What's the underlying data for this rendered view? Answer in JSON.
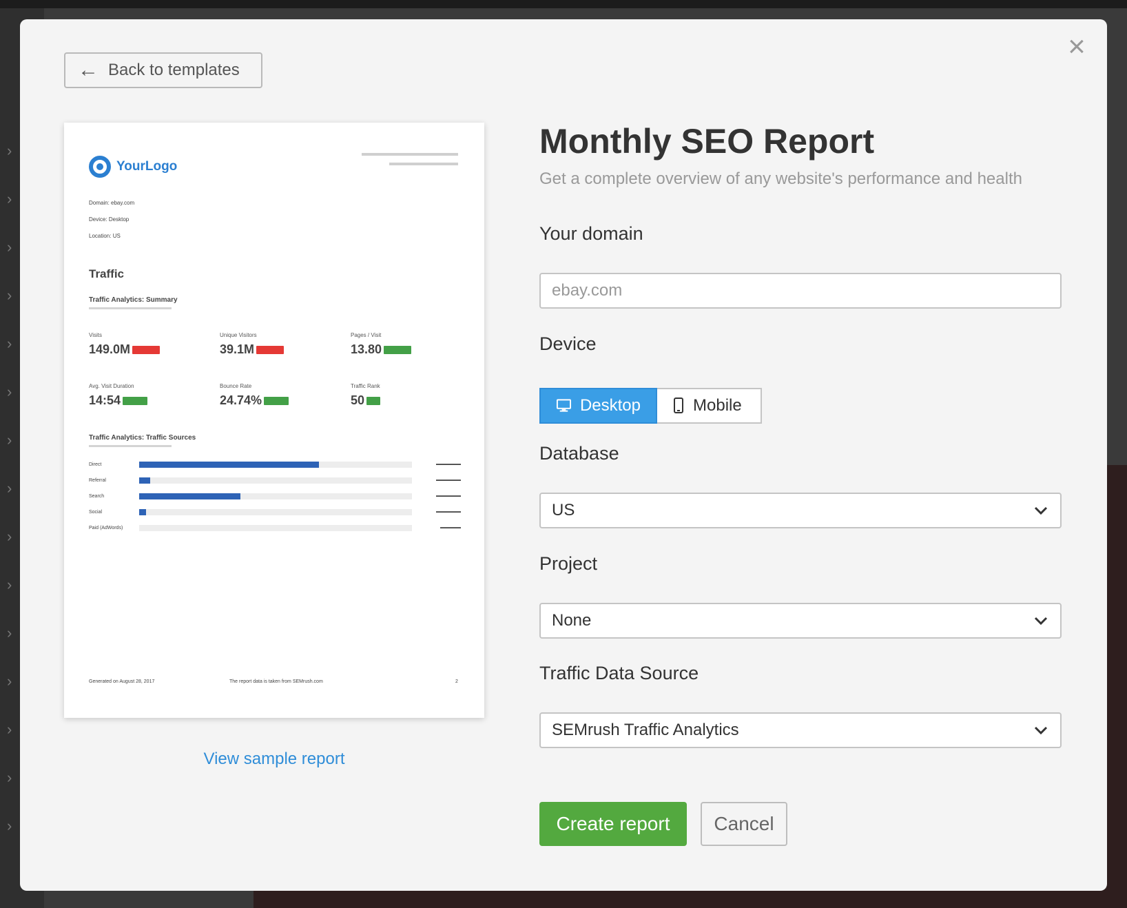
{
  "modal": {
    "close_icon": "×",
    "back_button": {
      "arrow": "←",
      "label": "Back to templates"
    },
    "view_sample_link": "View sample report"
  },
  "report_preview": {
    "logo_text": "YourLogo",
    "meta": [
      "Domain: ebay.com",
      "Device: Desktop",
      "Location: US"
    ],
    "section_title": "Traffic",
    "summary_title": "Traffic Analytics: Summary",
    "metrics": [
      {
        "label": "Visits",
        "value": "149.0M",
        "badge_color": "red"
      },
      {
        "label": "Unique Visitors",
        "value": "39.1M",
        "badge_color": "red"
      },
      {
        "label": "Pages / Visit",
        "value": "13.80",
        "badge_color": "green"
      },
      {
        "label": "Avg. Visit Duration",
        "value": "14:54",
        "badge_color": "green"
      },
      {
        "label": "Bounce Rate",
        "value": "24.74%",
        "badge_color": "green"
      },
      {
        "label": "Traffic Rank",
        "value": "50",
        "badge_color": "green"
      }
    ],
    "sources_title": "Traffic Analytics: Traffic Sources",
    "sources": [
      {
        "label": "Direct",
        "share": 0.66
      },
      {
        "label": "Referral",
        "share": 0.04
      },
      {
        "label": "Search",
        "share": 0.37
      },
      {
        "label": "Social",
        "share": 0.025
      },
      {
        "label": "Paid (AdWords)",
        "share": 0.0
      }
    ],
    "footer_left": "Generated on August 28, 2017",
    "footer_center": "The report data is taken from SEMrush.com",
    "footer_page": "2"
  },
  "form": {
    "title": "Monthly SEO Report",
    "subtitle": "Get a complete overview of any website's performance and health",
    "domain_label": "Your domain",
    "domain_placeholder": "ebay.com",
    "device_label": "Device",
    "device_options": {
      "desktop": "Desktop",
      "mobile": "Mobile",
      "selected": "Desktop"
    },
    "database_label": "Database",
    "database_value": "US",
    "project_label": "Project",
    "project_value": "None",
    "traffic_source_label": "Traffic Data Source",
    "traffic_source_value": "SEMrush Traffic Analytics",
    "create_button": "Create report",
    "cancel_button": "Cancel"
  },
  "colors": {
    "accent_blue": "#3a9ee6",
    "create_green": "#53a93f",
    "link_blue": "#2f8dd8"
  },
  "icons": {
    "back": "arrow-left-icon",
    "close": "close-icon",
    "desktop": "monitor-icon",
    "mobile": "phone-icon",
    "select": "chevron-down-icon"
  }
}
